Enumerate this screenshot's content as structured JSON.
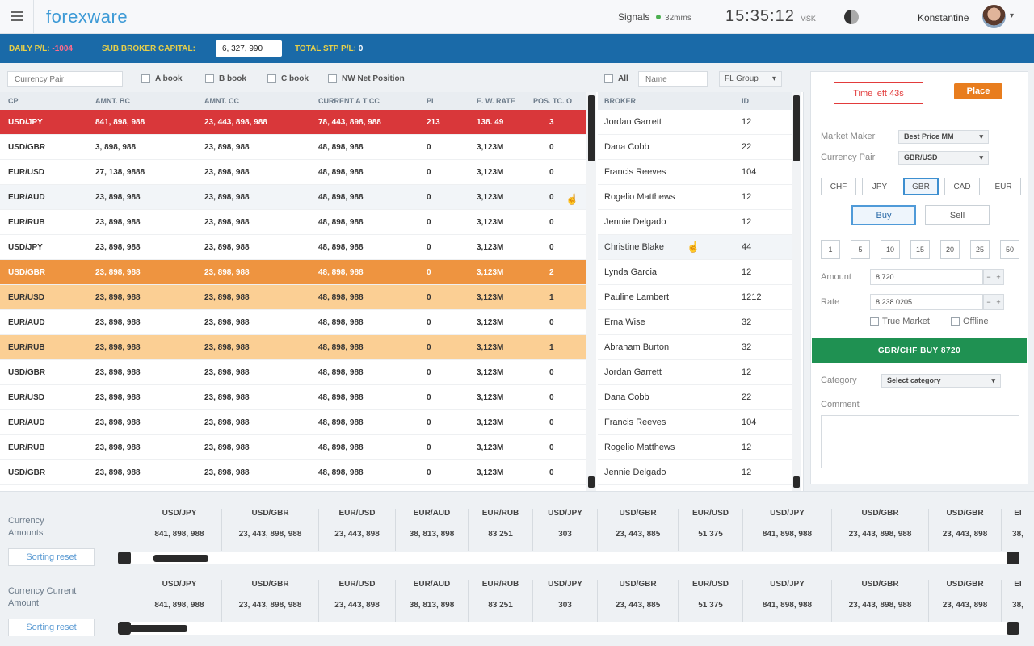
{
  "header": {
    "logo": "forexware",
    "signals_label": "Signals",
    "signals_value": "32mms",
    "clock": "15:35:12",
    "clock_suffix": "MSK",
    "username": "Konstantine"
  },
  "infobar": {
    "daily_pl_label": "DAILY P/L:",
    "daily_pl_value": "-1004",
    "sub_broker_capital_label": "SUB BROKER CAPITAL:",
    "sub_broker_capital_value": "6, 327, 990",
    "total_stp_label": "TOTAL STP P/L:",
    "total_stp_value": "0"
  },
  "filters": {
    "currency_pair_placeholder": "Currency Pair",
    "a_book": "A book",
    "b_book": "B book",
    "c_book": "C book",
    "nw_net": "NW Net Position",
    "all": "All",
    "name_placeholder": "Name",
    "group_select": "FL Group"
  },
  "main_table": {
    "headers": [
      "CP",
      "AMNT. BC",
      "AMNT. CC",
      "CURRENT A T CC",
      "PL",
      "E. W. RATE",
      "POS. TC. O"
    ],
    "rows": [
      {
        "cp": "USD/JPY",
        "bc": "841, 898, 988",
        "cc": "23, 443, 898, 988",
        "cur": "78, 443, 898, 988",
        "pl": "213",
        "rate": "138. 49",
        "pos": "3",
        "style": "red"
      },
      {
        "cp": "USD/GBR",
        "bc": "3, 898, 988",
        "cc": "23, 898, 988",
        "cur": "48, 898, 988",
        "pl": "0",
        "rate": "3,123M",
        "pos": "0",
        "style": ""
      },
      {
        "cp": "EUR/USD",
        "bc": "27, 138, 9888",
        "cc": "23, 898, 988",
        "cur": "48, 898, 988",
        "pl": "0",
        "rate": "3,123M",
        "pos": "0",
        "style": ""
      },
      {
        "cp": "EUR/AUD",
        "bc": "23, 898, 988",
        "cc": "23, 898, 988",
        "cur": "48, 898, 988",
        "pl": "0",
        "rate": "3,123M",
        "pos": "0",
        "style": "hover"
      },
      {
        "cp": "EUR/RUB",
        "bc": "23, 898, 988",
        "cc": "23, 898, 988",
        "cur": "48, 898, 988",
        "pl": "0",
        "rate": "3,123M",
        "pos": "0",
        "style": ""
      },
      {
        "cp": "USD/JPY",
        "bc": "23, 898, 988",
        "cc": "23, 898, 988",
        "cur": "48, 898, 988",
        "pl": "0",
        "rate": "3,123M",
        "pos": "0",
        "style": ""
      },
      {
        "cp": "USD/GBR",
        "bc": "23, 898, 988",
        "cc": "23, 898, 988",
        "cur": "48, 898, 988",
        "pl": "0",
        "rate": "3,123M",
        "pos": "2",
        "style": "orange"
      },
      {
        "cp": "EUR/USD",
        "bc": "23, 898, 988",
        "cc": "23, 898, 988",
        "cur": "48, 898, 988",
        "pl": "0",
        "rate": "3,123M",
        "pos": "1",
        "style": "peach"
      },
      {
        "cp": "EUR/AUD",
        "bc": "23, 898, 988",
        "cc": "23, 898, 988",
        "cur": "48, 898, 988",
        "pl": "0",
        "rate": "3,123M",
        "pos": "0",
        "style": ""
      },
      {
        "cp": "EUR/RUB",
        "bc": "23, 898, 988",
        "cc": "23, 898, 988",
        "cur": "48, 898, 988",
        "pl": "0",
        "rate": "3,123M",
        "pos": "1",
        "style": "peach"
      },
      {
        "cp": "USD/GBR",
        "bc": "23, 898, 988",
        "cc": "23, 898, 988",
        "cur": "48, 898, 988",
        "pl": "0",
        "rate": "3,123M",
        "pos": "0",
        "style": ""
      },
      {
        "cp": "EUR/USD",
        "bc": "23, 898, 988",
        "cc": "23, 898, 988",
        "cur": "48, 898, 988",
        "pl": "0",
        "rate": "3,123M",
        "pos": "0",
        "style": ""
      },
      {
        "cp": "EUR/AUD",
        "bc": "23, 898, 988",
        "cc": "23, 898, 988",
        "cur": "48, 898, 988",
        "pl": "0",
        "rate": "3,123M",
        "pos": "0",
        "style": ""
      },
      {
        "cp": "EUR/RUB",
        "bc": "23, 898, 988",
        "cc": "23, 898, 988",
        "cur": "48, 898, 988",
        "pl": "0",
        "rate": "3,123M",
        "pos": "0",
        "style": ""
      },
      {
        "cp": "USD/GBR",
        "bc": "23, 898, 988",
        "cc": "23, 898, 988",
        "cur": "48, 898, 988",
        "pl": "0",
        "rate": "3,123M",
        "pos": "0",
        "style": ""
      }
    ]
  },
  "broker_table": {
    "headers": [
      "BROKER",
      "ID"
    ],
    "rows": [
      {
        "name": "Jordan Garrett",
        "id": "12",
        "style": ""
      },
      {
        "name": "Dana Cobb",
        "id": "22",
        "style": ""
      },
      {
        "name": "Francis Reeves",
        "id": "104",
        "style": ""
      },
      {
        "name": "Rogelio Matthews",
        "id": "12",
        "style": ""
      },
      {
        "name": "Jennie Delgado",
        "id": "12",
        "style": ""
      },
      {
        "name": "Christine Blake",
        "id": "44",
        "style": "hover"
      },
      {
        "name": "Lynda Garcia",
        "id": "12",
        "style": ""
      },
      {
        "name": "Pauline Lambert",
        "id": "1212",
        "style": ""
      },
      {
        "name": "Erna Wise",
        "id": "32",
        "style": ""
      },
      {
        "name": "Abraham Burton",
        "id": "32",
        "style": ""
      },
      {
        "name": "Jordan Garrett",
        "id": "12",
        "style": ""
      },
      {
        "name": "Dana Cobb",
        "id": "22",
        "style": ""
      },
      {
        "name": "Francis Reeves",
        "id": "104",
        "style": ""
      },
      {
        "name": "Rogelio Matthews",
        "id": "12",
        "style": ""
      },
      {
        "name": "Jennie Delgado",
        "id": "12",
        "style": ""
      }
    ]
  },
  "order_panel": {
    "time_left_label": "Time left 43s",
    "place_label": "Place",
    "market_maker_label": "Market Maker",
    "market_maker_value": "Best Price MM",
    "currency_pair_label": "Currency Pair",
    "currency_pair_value": "GBR/USD",
    "currencies": [
      "CHF",
      "JPY",
      "GBR",
      "CAD",
      "EUR"
    ],
    "active_currency": "GBR",
    "buy_label": "Buy",
    "sell_label": "Sell",
    "amount_buttons": [
      "1",
      "5",
      "10",
      "15",
      "20",
      "25",
      "50"
    ],
    "amount_label": "Amount",
    "amount_value": "8,720",
    "rate_label": "Rate",
    "rate_value": "8,238 0205",
    "true_market_label": "True Market",
    "offline_label": "Offline",
    "submit_label": "GBR/CHF BUY 8720",
    "category_label": "Category",
    "category_value": "Select category",
    "comment_label": "Comment"
  },
  "bottom": {
    "currency_amounts_label": "Currency Amounts",
    "currency_current_label": "Currency Current Amount",
    "sorting_reset_label": "Sorting reset",
    "columns": [
      {
        "h": "USD/JPY",
        "v": "841, 898, 988"
      },
      {
        "h": "USD/GBR",
        "v": "23, 443, 898, 988"
      },
      {
        "h": "EUR/USD",
        "v": "23, 443, 898"
      },
      {
        "h": "EUR/AUD",
        "v": "38, 813, 898"
      },
      {
        "h": "EUR/RUB",
        "v": "83 251"
      },
      {
        "h": "USD/JPY",
        "v": "303"
      },
      {
        "h": "USD/GBR",
        "v": "23, 443, 885"
      },
      {
        "h": "EUR/USD",
        "v": "51 375"
      },
      {
        "h": "USD/JPY",
        "v": "841, 898, 988"
      },
      {
        "h": "USD/GBR",
        "v": "23, 443, 898, 988"
      },
      {
        "h": "USD/GBR",
        "v": "23, 443, 898"
      },
      {
        "h": "EI",
        "v": "38,"
      }
    ]
  }
}
